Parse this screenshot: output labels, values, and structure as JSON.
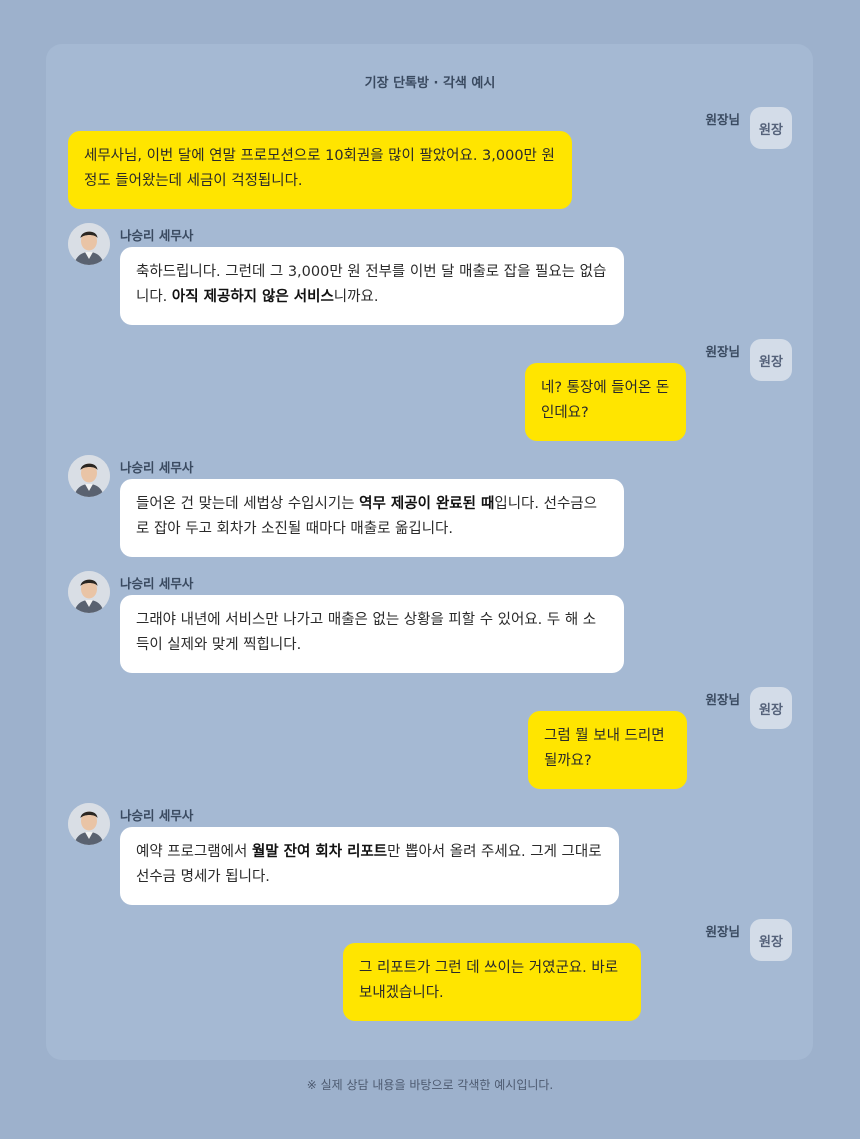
{
  "chat": {
    "title": "기장 단톡방 · 각색 예시",
    "client_name": "원장님",
    "client_avatar": "원장",
    "advisor_name": "나승리 세무사",
    "advisor_avatar_icon": "advisor-portrait-icon",
    "messages": [
      {
        "sender": "client",
        "parts": [
          "세무사님, 이번 달에 연말 프로모션으로 10회권을 많이 팔았어요. 3,000만 원 정도 들어왔는데 세금이 걱정됩니다."
        ]
      },
      {
        "sender": "advisor",
        "parts": [
          "축하드립니다. 그런데 그 3,000만 원 전부를 이번 달 매출로 잡을 필요는 없습니다. ",
          "아직 제공하지 않은 서비스",
          "니까요."
        ]
      },
      {
        "sender": "client",
        "parts": [
          "네? 통장에 들어온 돈인데요?"
        ]
      },
      {
        "sender": "advisor",
        "parts": [
          "들어온 건 맞는데 세법상 수입시기는 ",
          "역무 제공이 완료된 때",
          "입니다. 선수금으로 잡아 두고 회차가 소진될 때마다 매출로 옮깁니다."
        ]
      },
      {
        "sender": "advisor",
        "parts": [
          "그래야 내년에 서비스만 나가고 매출은 없는 상황을 피할 수 있어요. 두 해 소득이 실제와 맞게 찍힙니다."
        ]
      },
      {
        "sender": "client",
        "parts": [
          "그럼 뭘 보내 드리면 될까요?"
        ]
      },
      {
        "sender": "advisor",
        "parts": [
          "예약 프로그램에서 ",
          "월말 잔여 회차 리포트",
          "만 뽑아서 올려 주세요. 그게 그대로 선수금 명세가 됩니다."
        ]
      },
      {
        "sender": "client",
        "parts": [
          "그 리포트가 그런 데 쓰이는 거였군요. 바로 보내겠습니다."
        ]
      }
    ]
  },
  "footnote": "※ 실제 상담 내용을 바탕으로 각색한 예시입니다.",
  "colors": {
    "background": "#9db1cc",
    "panel": "#a5b9d3",
    "client_bubble": "#ffe500",
    "advisor_bubble": "#ffffff"
  }
}
